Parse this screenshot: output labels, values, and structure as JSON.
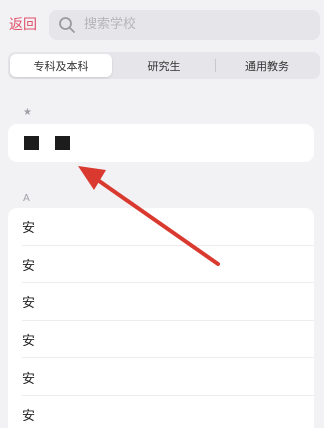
{
  "header": {
    "back_label": "返回",
    "search_placeholder": "搜索学校"
  },
  "tabs": [
    {
      "label": "专科及本科",
      "active": true
    },
    {
      "label": "研究生",
      "active": false
    },
    {
      "label": "通用教务",
      "active": false
    }
  ],
  "favorites": {
    "header": "★"
  },
  "section_a": {
    "header": "A",
    "items": [
      "安",
      "安",
      "安",
      "安",
      "安",
      "安"
    ]
  },
  "colors": {
    "accent": "#e0506a",
    "background": "#f2f2f5",
    "annotation_arrow": "#d9392e"
  }
}
